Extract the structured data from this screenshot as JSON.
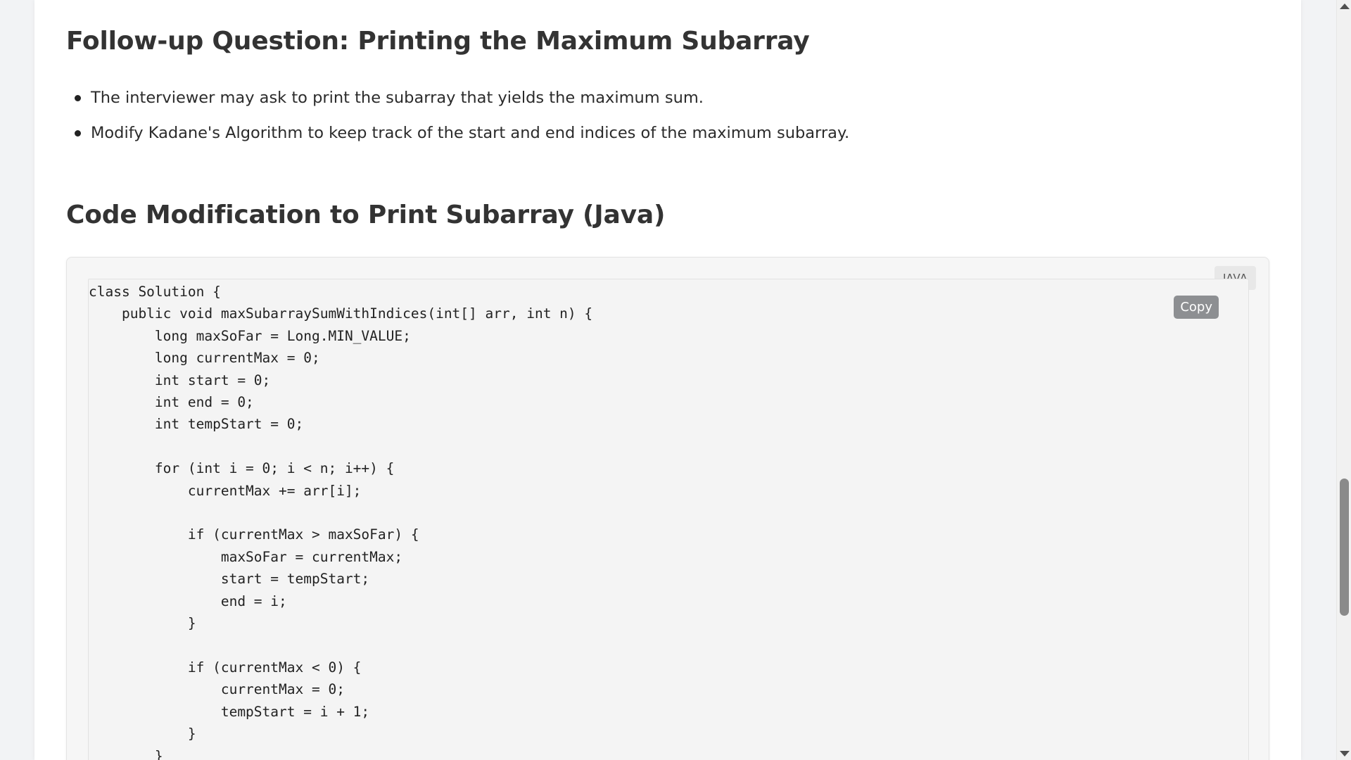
{
  "sections": {
    "followup_heading": "Follow-up Question: Printing the Maximum Subarray",
    "followup_bullets": [
      "The interviewer may ask to print the subarray that yields the maximum sum.",
      "Modify Kadane's Algorithm to keep track of the start and end indices of the maximum subarray."
    ],
    "code_heading": "Code Modification to Print Subarray (Java)"
  },
  "code_block": {
    "language_badge": "JAVA",
    "copy_label": "Copy",
    "code": "class Solution {\n    public void maxSubarraySumWithIndices(int[] arr, int n) {\n        long maxSoFar = Long.MIN_VALUE;\n        long currentMax = 0;\n        int start = 0;\n        int end = 0;\n        int tempStart = 0;\n\n        for (int i = 0; i < n; i++) {\n            currentMax += arr[i];\n\n            if (currentMax > maxSoFar) {\n                maxSoFar = currentMax;\n                start = tempStart;\n                end = i;\n            }\n\n            if (currentMax < 0) {\n                currentMax = 0;\n                tempStart = i + 1;\n            }\n        }"
  },
  "scrollbar": {
    "up_icon": "triangle-up",
    "down_icon": "triangle-down"
  }
}
